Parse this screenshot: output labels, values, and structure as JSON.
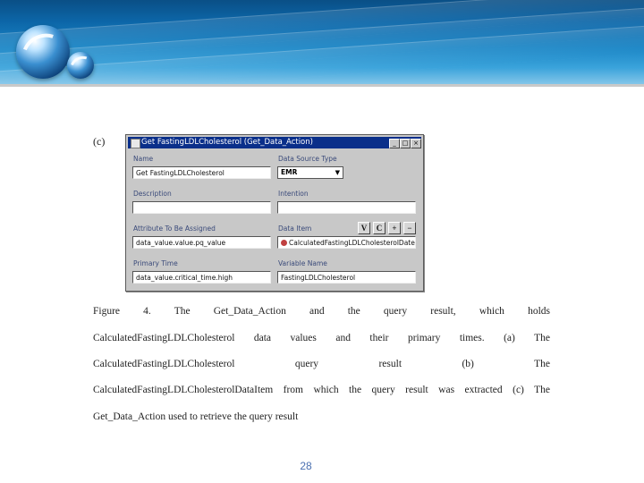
{
  "dialog": {
    "panel_label": "(c)",
    "title": "Get FastingLDLCholesterol (Get_Data_Action)",
    "labels": {
      "name": "Name",
      "data_source_type": "Data Source Type",
      "description": "Description",
      "intention": "Intention",
      "attribute": "Attribute To Be Assigned",
      "data_item": "Data Item",
      "primary_time": "Primary Time",
      "variable_name": "Variable Name"
    },
    "values": {
      "name": "Get FastingLDLCholesterol",
      "data_source_type": "EMR",
      "description": "",
      "intention": "",
      "attribute": "data_value.value.pq_value",
      "data_item": "CalculatedFastingLDLCholesterolDate",
      "primary_time": "data_value.critical_time.high",
      "variable_name": "FastingLDLCholesterol"
    },
    "buttons": {
      "v": "V",
      "c": "C",
      "plus": "+",
      "minus": "−"
    },
    "title_buttons": {
      "minimize": "_",
      "maximize": "□",
      "close": "×"
    }
  },
  "caption": {
    "lines": [
      "Figure 4. The Get_Data_Action and the query result, which holds",
      "CalculatedFastingLDLCholesterol data values and their primary times. (a) The",
      "CalculatedFastingLDLCholesterol query result (b) The",
      "CalculatedFastingLDLCholesterolDataItem from which the query result was extracted (c) The",
      "Get_Data_Action used to retrieve the query result"
    ]
  },
  "page_number": "28",
  "colors": {
    "banner": "#1b86c6",
    "titlebar": "#0a2f8a",
    "page_number": "#4a6fb0"
  },
  "icons": [
    "logo-globe-icon",
    "combo-arrow-icon",
    "data-item-icon"
  ]
}
